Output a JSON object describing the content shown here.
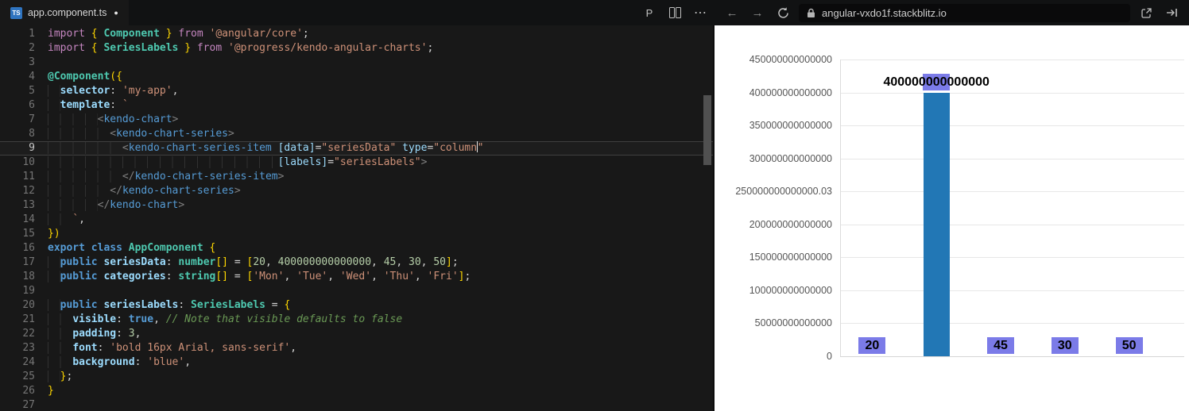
{
  "editor_header": {
    "tab": {
      "file_type_badge": "TS",
      "label": "app.component.ts",
      "modified_indicator": "●"
    },
    "actions": {
      "prettier": "P",
      "more": "⋯"
    }
  },
  "preview_toolbar": {
    "back": "←",
    "forward": "→",
    "url": "angular-vxdo1f.stackblitz.io"
  },
  "editor": {
    "active_line": 9,
    "lines": [
      {
        "n": 1,
        "t": [
          [
            "kw",
            "import"
          ],
          [
            "pun",
            " "
          ],
          [
            "gold",
            "{"
          ],
          [
            "type",
            " Component "
          ],
          [
            "gold",
            "}"
          ],
          [
            "pun",
            " "
          ],
          [
            "kw",
            "from"
          ],
          [
            "pun",
            " "
          ],
          [
            "str",
            "'@angular/core'"
          ],
          [
            "pun",
            ";"
          ]
        ]
      },
      {
        "n": 2,
        "t": [
          [
            "kw",
            "import"
          ],
          [
            "pun",
            " "
          ],
          [
            "gold",
            "{"
          ],
          [
            "type",
            " SeriesLabels "
          ],
          [
            "gold",
            "}"
          ],
          [
            "pun",
            " "
          ],
          [
            "kw",
            "from"
          ],
          [
            "pun",
            " "
          ],
          [
            "str",
            "'@progress/kendo-angular-charts'"
          ],
          [
            "pun",
            ";"
          ]
        ]
      },
      {
        "n": 3,
        "t": []
      },
      {
        "n": 4,
        "t": [
          [
            "dec",
            "@Component"
          ],
          [
            "gold",
            "({"
          ]
        ]
      },
      {
        "n": 5,
        "t": [
          [
            "ws",
            "  "
          ],
          [
            "prop",
            "selector"
          ],
          [
            "pun",
            ": "
          ],
          [
            "str",
            "'my-app'"
          ],
          [
            "pun",
            ","
          ]
        ]
      },
      {
        "n": 6,
        "t": [
          [
            "ws",
            "  "
          ],
          [
            "prop",
            "template"
          ],
          [
            "pun",
            ": "
          ],
          [
            "str",
            "`"
          ]
        ]
      },
      {
        "n": 7,
        "t": [
          [
            "ws",
            "        "
          ],
          [
            "dim",
            "<"
          ],
          [
            "tag",
            "kendo-chart"
          ],
          [
            "dim",
            ">"
          ]
        ]
      },
      {
        "n": 8,
        "t": [
          [
            "ws",
            "          "
          ],
          [
            "dim",
            "<"
          ],
          [
            "tag",
            "kendo-chart-series"
          ],
          [
            "dim",
            ">"
          ]
        ]
      },
      {
        "n": 9,
        "t": [
          [
            "ws",
            "            "
          ],
          [
            "dim",
            "<"
          ],
          [
            "tag",
            "kendo-chart-series-item"
          ],
          [
            "pun",
            " "
          ],
          [
            "attr",
            "[data]"
          ],
          [
            "pun",
            "="
          ],
          [
            "str",
            "\"seriesData\""
          ],
          [
            "pun",
            " "
          ],
          [
            "attr",
            "type"
          ],
          [
            "pun",
            "="
          ],
          [
            "str",
            "\"column"
          ],
          [
            "cur",
            ""
          ],
          [
            "str",
            "\""
          ]
        ]
      },
      {
        "n": 10,
        "t": [
          [
            "ws",
            "                                     "
          ],
          [
            "attr",
            "[labels]"
          ],
          [
            "pun",
            "="
          ],
          [
            "str",
            "\"seriesLabels\""
          ],
          [
            "dim",
            ">"
          ]
        ]
      },
      {
        "n": 11,
        "t": [
          [
            "ws",
            "            "
          ],
          [
            "dim",
            "</"
          ],
          [
            "tag",
            "kendo-chart-series-item"
          ],
          [
            "dim",
            ">"
          ]
        ]
      },
      {
        "n": 12,
        "t": [
          [
            "ws",
            "          "
          ],
          [
            "dim",
            "</"
          ],
          [
            "tag",
            "kendo-chart-series"
          ],
          [
            "dim",
            ">"
          ]
        ]
      },
      {
        "n": 13,
        "t": [
          [
            "ws",
            "        "
          ],
          [
            "dim",
            "</"
          ],
          [
            "tag",
            "kendo-chart"
          ],
          [
            "dim",
            ">"
          ]
        ]
      },
      {
        "n": 14,
        "t": [
          [
            "ws",
            "    "
          ],
          [
            "str",
            "`"
          ],
          [
            "pun",
            ","
          ]
        ]
      },
      {
        "n": 15,
        "t": [
          [
            "gold",
            "})"
          ]
        ]
      },
      {
        "n": 16,
        "t": [
          [
            "kw2",
            "export"
          ],
          [
            "pun",
            " "
          ],
          [
            "kw2",
            "class"
          ],
          [
            "pun",
            " "
          ],
          [
            "type",
            "AppComponent"
          ],
          [
            "pun",
            " "
          ],
          [
            "gold",
            "{"
          ]
        ]
      },
      {
        "n": 17,
        "t": [
          [
            "ws",
            "  "
          ],
          [
            "kw2",
            "public"
          ],
          [
            "pun",
            " "
          ],
          [
            "prop",
            "seriesData"
          ],
          [
            "pun",
            ": "
          ],
          [
            "type",
            "number"
          ],
          [
            "gold",
            "[]"
          ],
          [
            "pun",
            " = "
          ],
          [
            "gold",
            "["
          ],
          [
            "num",
            "20"
          ],
          [
            "pun",
            ", "
          ],
          [
            "num",
            "400000000000000"
          ],
          [
            "pun",
            ", "
          ],
          [
            "num",
            "45"
          ],
          [
            "pun",
            ", "
          ],
          [
            "num",
            "30"
          ],
          [
            "pun",
            ", "
          ],
          [
            "num",
            "50"
          ],
          [
            "gold",
            "]"
          ],
          [
            "pun",
            ";"
          ]
        ]
      },
      {
        "n": 18,
        "t": [
          [
            "ws",
            "  "
          ],
          [
            "kw2",
            "public"
          ],
          [
            "pun",
            " "
          ],
          [
            "prop",
            "categories"
          ],
          [
            "pun",
            ": "
          ],
          [
            "type",
            "string"
          ],
          [
            "gold",
            "[]"
          ],
          [
            "pun",
            " = "
          ],
          [
            "gold",
            "["
          ],
          [
            "str",
            "'Mon'"
          ],
          [
            "pun",
            ", "
          ],
          [
            "str",
            "'Tue'"
          ],
          [
            "pun",
            ", "
          ],
          [
            "str",
            "'Wed'"
          ],
          [
            "pun",
            ", "
          ],
          [
            "str",
            "'Thu'"
          ],
          [
            "pun",
            ", "
          ],
          [
            "str",
            "'Fri'"
          ],
          [
            "gold",
            "]"
          ],
          [
            "pun",
            ";"
          ]
        ]
      },
      {
        "n": 19,
        "t": []
      },
      {
        "n": 20,
        "t": [
          [
            "ws",
            "  "
          ],
          [
            "kw2",
            "public"
          ],
          [
            "pun",
            " "
          ],
          [
            "prop",
            "seriesLabels"
          ],
          [
            "pun",
            ": "
          ],
          [
            "type",
            "SeriesLabels"
          ],
          [
            "pun",
            " = "
          ],
          [
            "gold",
            "{"
          ]
        ]
      },
      {
        "n": 21,
        "t": [
          [
            "ws",
            "    "
          ],
          [
            "prop",
            "visible"
          ],
          [
            "pun",
            ": "
          ],
          [
            "kw2",
            "true"
          ],
          [
            "pun",
            ", "
          ],
          [
            "cmt",
            "// Note that visible defaults to false"
          ]
        ]
      },
      {
        "n": 22,
        "t": [
          [
            "ws",
            "    "
          ],
          [
            "prop",
            "padding"
          ],
          [
            "pun",
            ": "
          ],
          [
            "num",
            "3"
          ],
          [
            "pun",
            ","
          ]
        ]
      },
      {
        "n": 23,
        "t": [
          [
            "ws",
            "    "
          ],
          [
            "prop",
            "font"
          ],
          [
            "pun",
            ": "
          ],
          [
            "str",
            "'bold 16px Arial, sans-serif'"
          ],
          [
            "pun",
            ","
          ]
        ]
      },
      {
        "n": 24,
        "t": [
          [
            "ws",
            "    "
          ],
          [
            "prop",
            "background"
          ],
          [
            "pun",
            ": "
          ],
          [
            "str",
            "'blue'"
          ],
          [
            "pun",
            ","
          ]
        ]
      },
      {
        "n": 25,
        "t": [
          [
            "ws",
            "  "
          ],
          [
            "gold",
            "}"
          ],
          [
            "pun",
            ";"
          ]
        ]
      },
      {
        "n": 26,
        "t": [
          [
            "gold",
            "}"
          ]
        ]
      },
      {
        "n": 27,
        "t": []
      }
    ]
  },
  "chart_data": {
    "type": "bar",
    "values": [
      20,
      400000000000000,
      45,
      30,
      50
    ],
    "series_labels": [
      "20",
      "400000000000000",
      "45",
      "30",
      "50"
    ],
    "y_ticks": [
      "450000000000000",
      "400000000000000",
      "350000000000000",
      "300000000000000",
      "250000000000000.03",
      "200000000000000",
      "150000000000000",
      "100000000000000",
      "50000000000000",
      "0"
    ],
    "ylim": [
      0,
      450000000000000
    ],
    "grid": true,
    "legend": "none",
    "bar_color": "#2277b5",
    "label_background": "#7b7be8",
    "label_text_color": "#000000"
  }
}
